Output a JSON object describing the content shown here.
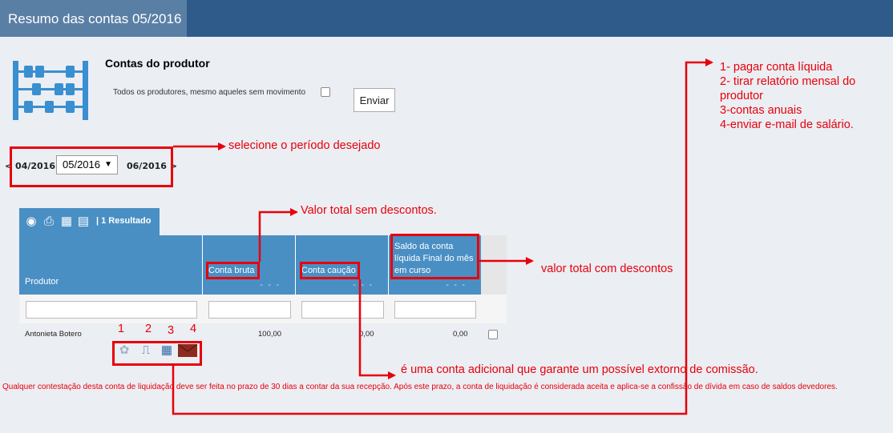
{
  "header": {
    "title": "Resumo das contas 05/2016"
  },
  "section": {
    "title": "Contas do produtor",
    "checkbox_label": "Todos os produtores, mesmo aqueles sem movimento",
    "submit_label": "Enviar"
  },
  "period": {
    "prev": "< 04/2016",
    "selected": "05/2016",
    "next": "06/2016 >"
  },
  "table": {
    "result_count": "| 1 Resultado",
    "columns": [
      {
        "label": "Produtor"
      },
      {
        "label": "Conta bruta",
        "dashes": "- - -"
      },
      {
        "label": "Conta caução",
        "dashes": "- - -"
      },
      {
        "label": "Saldo da conta líquida Final do mês em curso",
        "dashes": "- - -"
      }
    ],
    "rows": [
      {
        "produtor": "Antonieta Botero",
        "conta_bruta": "100,00",
        "conta_caucao": "0,00",
        "saldo": "0,00"
      }
    ]
  },
  "actions": {
    "numbers": [
      "1",
      "2",
      "3",
      "4"
    ],
    "icons": [
      "pay-icon",
      "pdf-icon",
      "calculator-icon",
      "envelope-icon"
    ]
  },
  "annotations": {
    "period": "selecione o período desejado",
    "gross": "Valor total sem descontos.",
    "net": "valor total com descontos",
    "caucao": "é uma conta adicional que garante um possível extorno de comissão.",
    "actions_list": [
      "1- pagar conta líquida",
      "2- tirar relatório mensal do produtor",
      "3-contas anuais",
      "4-enviar e-mail de salário."
    ]
  },
  "footer": {
    "note": "Qualquer contestação desta conta de liquidação deve ser feita no prazo de 30 dias a contar da sua recepção. Após este prazo, a conta de liquidação é considerada aceita e aplica-se a confissão de dívida em caso de saldos devedores."
  },
  "colors": {
    "header_bg": "#2e5b8a",
    "table_blue": "#4a8fc4",
    "annotation_red": "#e8000b"
  }
}
